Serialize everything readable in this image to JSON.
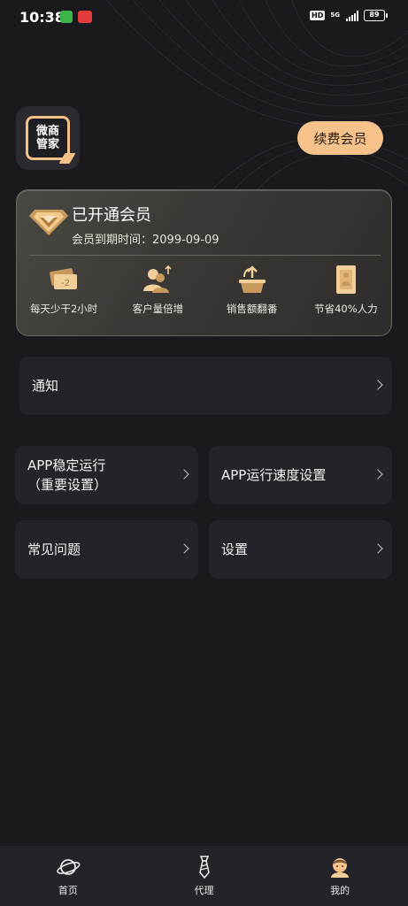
{
  "status_bar": {
    "time": "10:38",
    "network_label": "5G",
    "battery": "89"
  },
  "header": {
    "logo_text_line1": "微商",
    "logo_text_line2": "管家",
    "renew_button": "续费会员"
  },
  "member_card": {
    "title": "已开通会员",
    "expiry": "会员到期时间：2099-09-09",
    "benefits": [
      {
        "icon": "ticket-minus-icon",
        "label": "每天少干2小时"
      },
      {
        "icon": "customers-up-icon",
        "label": "客户量倍增"
      },
      {
        "icon": "sales-basket-icon",
        "label": "销售额翻番"
      },
      {
        "icon": "save-manpower-icon",
        "label": "节省40%人力"
      }
    ]
  },
  "menu": {
    "notice": "通知",
    "app_stable_line1": "APP稳定运行",
    "app_stable_line2": "（重要设置）",
    "app_speed": "APP运行速度设置",
    "faq": "常见问题",
    "settings": "设置"
  },
  "bottom_nav": [
    {
      "icon": "planet-icon",
      "label": "首页"
    },
    {
      "icon": "tie-icon",
      "label": "代理"
    },
    {
      "icon": "user-icon",
      "label": "我的"
    }
  ],
  "colors": {
    "accent": "#f6c18a",
    "background": "#1a191e",
    "card": "#242329"
  }
}
